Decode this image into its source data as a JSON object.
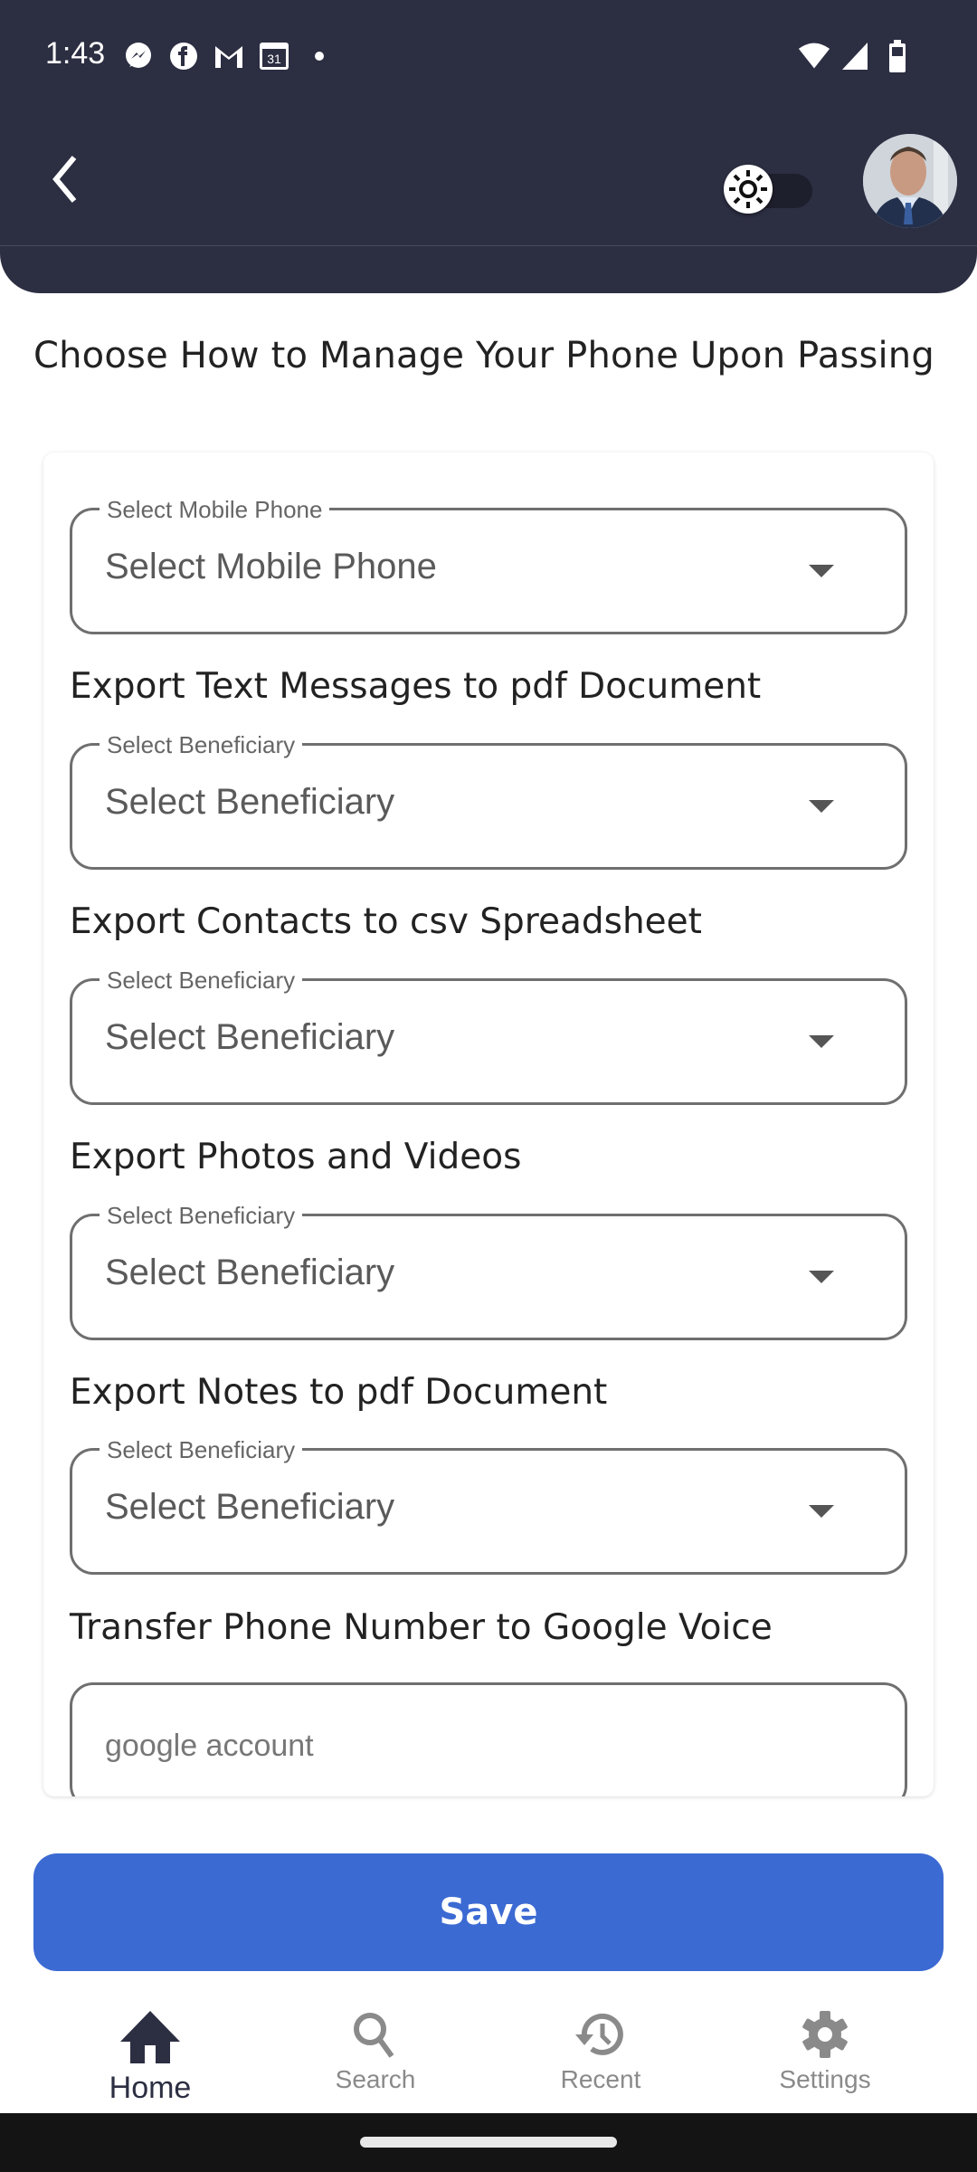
{
  "status_bar": {
    "time": "1:43",
    "notification_icons": [
      "messenger-icon",
      "facebook-icon",
      "gmail-icon",
      "calendar-icon",
      "dot-icon"
    ],
    "calendar_day": "31",
    "system_icons": [
      "wifi-icon",
      "signal-icon",
      "battery-icon"
    ]
  },
  "app_bar": {
    "back_icon": "chevron-left-icon",
    "theme_toggle": {
      "icon": "sun-icon",
      "state": "light"
    },
    "avatar": "user-avatar"
  },
  "page": {
    "title": "Choose How to Manage Your Phone Upon Passing"
  },
  "form": {
    "mobile_phone": {
      "label": "Select Mobile Phone",
      "value": "Select Mobile Phone"
    },
    "sections": [
      {
        "title": "Export Text Messages to pdf Document",
        "label": "Select Beneficiary",
        "value": "Select Beneficiary"
      },
      {
        "title": "Export Contacts to csv Spreadsheet",
        "label": "Select Beneficiary",
        "value": "Select Beneficiary"
      },
      {
        "title": "Export Photos and Videos",
        "label": "Select Beneficiary",
        "value": "Select Beneficiary"
      },
      {
        "title": "Export Notes to pdf Document",
        "label": "Select Beneficiary",
        "value": "Select Beneficiary"
      }
    ],
    "google_voice": {
      "title": "Transfer Phone Number to Google Voice",
      "placeholder": "google account",
      "value": ""
    }
  },
  "actions": {
    "save_label": "Save",
    "save_color": "#3c6ad3"
  },
  "bottom_nav": {
    "items": [
      {
        "label": "Home",
        "icon": "home-icon",
        "active": true
      },
      {
        "label": "Search",
        "icon": "search-icon",
        "active": false
      },
      {
        "label": "Recent",
        "icon": "history-icon",
        "active": false
      },
      {
        "label": "Settings",
        "icon": "gear-icon",
        "active": false
      }
    ]
  },
  "colors": {
    "header_bg": "#2c2e42",
    "accent": "#3c6ad3",
    "nav_active": "#2c2e42",
    "nav_inactive": "#8a8a8a"
  }
}
